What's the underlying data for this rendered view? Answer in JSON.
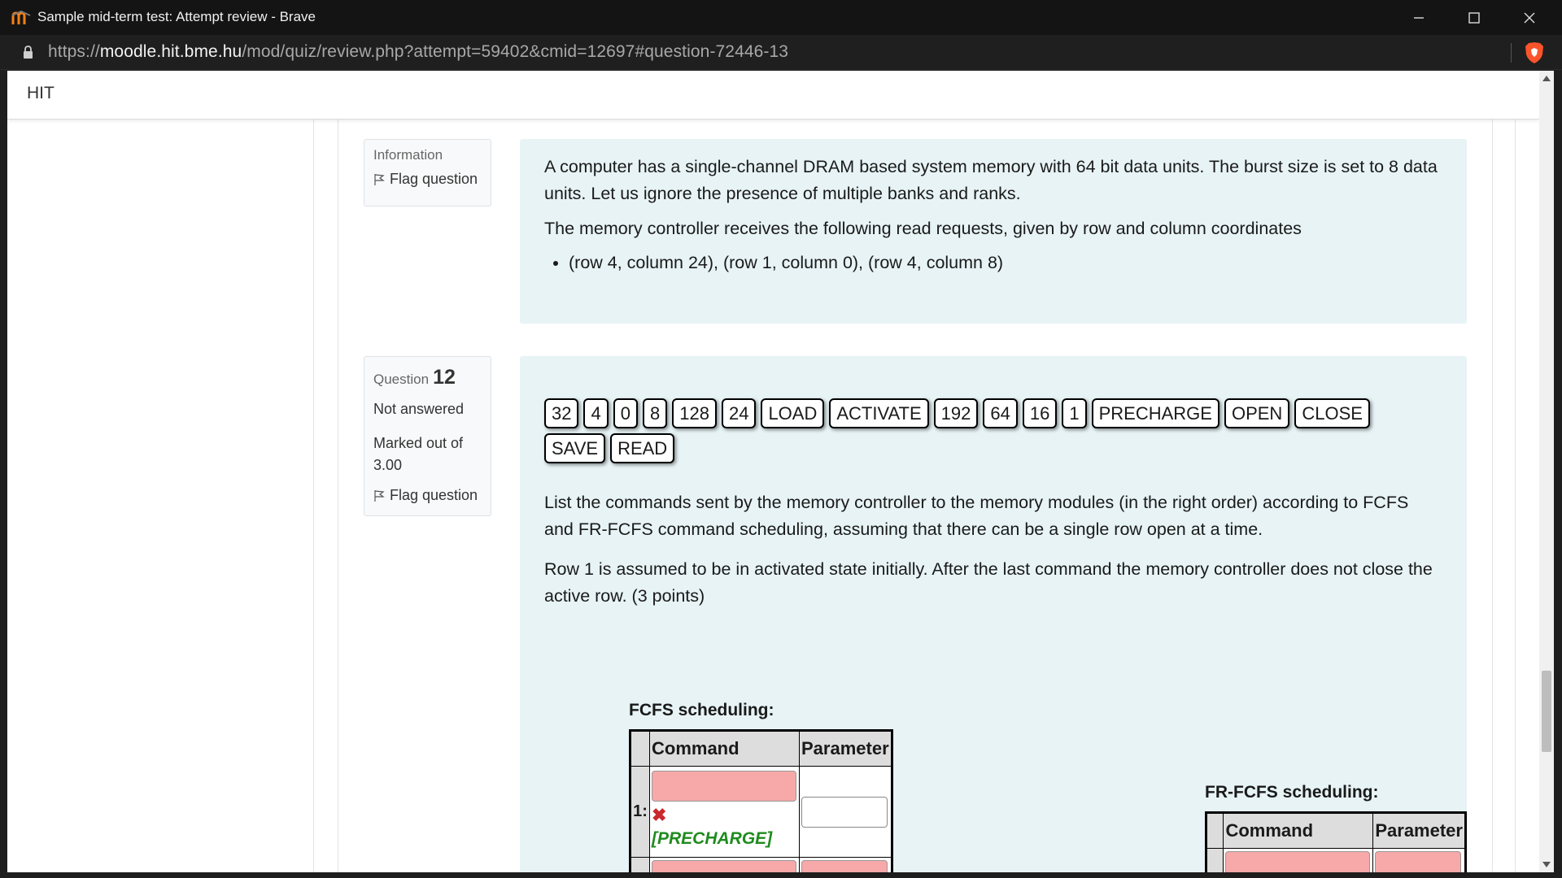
{
  "window": {
    "title": "Sample mid-term test: Attempt review - Brave",
    "url_scheme": "https://",
    "url_domain": "moodle.hit.bme.hu",
    "url_path": "/mod/quiz/review.php?attempt=59402&cmid=12697#question-72446-13"
  },
  "navbar": {
    "brand": "HIT"
  },
  "info_block": {
    "label": "Information",
    "flag_label": "Flag question",
    "paragraph1": "A computer has a single-channel DRAM based system memory with 64 bit data units. The burst size is set to 8 data units. Let us ignore the presence of multiple banks and ranks.",
    "paragraph2": "The memory controller receives the following read requests, given by row and column coordinates",
    "bullet": "(row 4, column 24), (row 1, column 0), (row 4, column 8)"
  },
  "question": {
    "prefix": "Question",
    "number": "12",
    "state": "Not answered",
    "marked_out_of": "Marked out of 3.00",
    "flag_label": "Flag question",
    "choices": [
      "32",
      "4",
      "0",
      "8",
      "128",
      "24",
      "LOAD",
      "ACTIVATE",
      "192",
      "64",
      "16",
      "1",
      "PRECHARGE",
      "OPEN",
      "CLOSE",
      "SAVE",
      "READ"
    ],
    "text1": "List the commands sent by the memory controller to the memory modules (in the right order) according to FCFS and FR-FCFS command scheduling, assuming that there can be a single row open at a time.",
    "text2": "Row 1 is assumed to be in activated state initially. After the last command the memory controller does not close the active row. (3 points)"
  },
  "fcfs": {
    "heading": "FCFS scheduling:",
    "col_command": "Command",
    "col_parameter": "Parameter",
    "row1_num": "1:",
    "row1_correct": "[PRECHARGE]"
  },
  "frfcfs": {
    "heading": "FR-FCFS scheduling:",
    "col_command": "Command",
    "col_parameter": "Parameter"
  },
  "colors": {
    "content_bg": "#e7f3f5",
    "wrong_drop": "#f7a8a8",
    "correct_text": "#1f8b1f",
    "wrong_mark": "#c9282d"
  }
}
